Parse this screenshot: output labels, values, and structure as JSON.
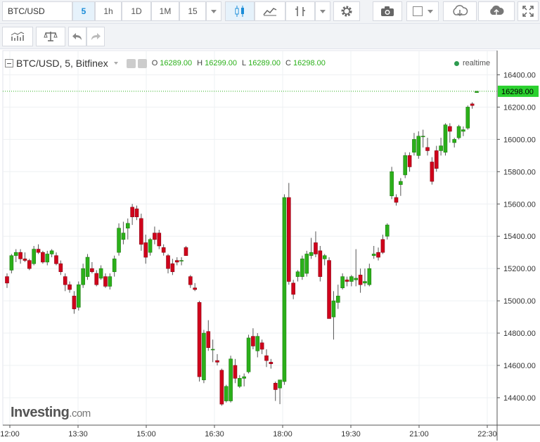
{
  "toolbar": {
    "symbol": "BTC/USD",
    "intervals": [
      "5",
      "1h",
      "1D",
      "1M",
      "15"
    ],
    "active_interval": "5"
  },
  "legend": {
    "title": "BTC/USD, 5, Bitfinex",
    "o_label": "O",
    "o_value": "16289.00",
    "h_label": "H",
    "h_value": "16299.00",
    "l_label": "L",
    "l_value": "16289.00",
    "c_label": "C",
    "c_value": "16298.00"
  },
  "realtime_label": "realtime",
  "logo": {
    "main": "Investing",
    "suffix": ".com"
  },
  "colors": {
    "up": "#2bb01a",
    "down": "#d0021b",
    "last_price_bg": "#2bd12f",
    "grid": "#eef0f3"
  },
  "chart_data": {
    "type": "candlestick",
    "y_ticks": [
      14400,
      14600,
      14800,
      15000,
      15200,
      15400,
      15600,
      15800,
      16000,
      16200,
      16400
    ],
    "y_tick_labels": [
      "14400.00",
      "14600.00",
      "14800.00",
      "15000.00",
      "15200.00",
      "15400.00",
      "15600.00",
      "15800.00",
      "16000.00",
      "16200.00",
      "16400.00"
    ],
    "ylim": [
      14230,
      16550
    ],
    "x_tick_labels": [
      "12:00",
      "13:30",
      "15:00",
      "16:30",
      "18:00",
      "19:30",
      "21:00",
      "22:30"
    ],
    "last_price": 16298.0,
    "last_price_label": "16298.00",
    "candles": [
      [
        15150,
        15170,
        15080,
        15110
      ],
      [
        15190,
        15290,
        15170,
        15280
      ],
      [
        15280,
        15320,
        15240,
        15300
      ],
      [
        15300,
        15320,
        15230,
        15260
      ],
      [
        15260,
        15300,
        15240,
        15250
      ],
      [
        15250,
        15260,
        15190,
        15200
      ],
      [
        15230,
        15340,
        15220,
        15320
      ],
      [
        15320,
        15350,
        15290,
        15300
      ],
      [
        15300,
        15310,
        15230,
        15240
      ],
      [
        15240,
        15310,
        15220,
        15290
      ],
      [
        15290,
        15320,
        15270,
        15310
      ],
      [
        15280,
        15300,
        15220,
        15230
      ],
      [
        15230,
        15250,
        15160,
        15180
      ],
      [
        15150,
        15170,
        15060,
        15100
      ],
      [
        15100,
        15120,
        15050,
        15070
      ],
      [
        15030,
        15060,
        14920,
        14950
      ],
      [
        14960,
        15120,
        14940,
        15100
      ],
      [
        15100,
        15230,
        15080,
        15200
      ],
      [
        15150,
        15290,
        15130,
        15270
      ],
      [
        15200,
        15240,
        15170,
        15180
      ],
      [
        15170,
        15190,
        15090,
        15100
      ],
      [
        15140,
        15220,
        15130,
        15200
      ],
      [
        15150,
        15170,
        15080,
        15090
      ],
      [
        15090,
        15170,
        15070,
        15150
      ],
      [
        15180,
        15280,
        15150,
        15260
      ],
      [
        15300,
        15480,
        15280,
        15450
      ],
      [
        15380,
        15490,
        15350,
        15420
      ],
      [
        15450,
        15510,
        15380,
        15480
      ],
      [
        15580,
        15600,
        15470,
        15520
      ],
      [
        15570,
        15590,
        15500,
        15520
      ],
      [
        15510,
        15540,
        15310,
        15350
      ],
      [
        15360,
        15410,
        15230,
        15270
      ],
      [
        15300,
        15390,
        15280,
        15380
      ],
      [
        15420,
        15460,
        15350,
        15380
      ],
      [
        15420,
        15440,
        15320,
        15340
      ],
      [
        15330,
        15350,
        15280,
        15300
      ],
      [
        15280,
        15290,
        15170,
        15200
      ],
      [
        15230,
        15260,
        15160,
        15180
      ],
      [
        15250,
        15270,
        15220,
        15240
      ],
      [
        15250,
        15270,
        15220,
        15250
      ],
      [
        15330,
        15340,
        15280,
        15280
      ],
      [
        15150,
        15160,
        15080,
        15100
      ],
      [
        15080,
        15110,
        15060,
        15070
      ],
      [
        14990,
        15000,
        14500,
        14530
      ],
      [
        14510,
        14820,
        14490,
        14800
      ],
      [
        14810,
        14880,
        14690,
        14710
      ],
      [
        14700,
        14760,
        14620,
        14700
      ],
      [
        14630,
        14670,
        14600,
        14620
      ],
      [
        14570,
        14580,
        14350,
        14360
      ],
      [
        14380,
        14480,
        14370,
        14470
      ],
      [
        14380,
        14660,
        14370,
        14640
      ],
      [
        14600,
        14640,
        14490,
        14520
      ],
      [
        14470,
        14540,
        14460,
        14520
      ],
      [
        14520,
        14550,
        14470,
        14530
      ],
      [
        14560,
        14790,
        14550,
        14770
      ],
      [
        14780,
        14830,
        14700,
        14720
      ],
      [
        14690,
        14800,
        14650,
        14780
      ],
      [
        14740,
        14760,
        14670,
        14700
      ],
      [
        14660,
        14700,
        14590,
        14630
      ],
      [
        14620,
        14640,
        14580,
        14610
      ],
      [
        14490,
        14500,
        14380,
        14450
      ],
      [
        14460,
        14480,
        14360,
        14510
      ],
      [
        14500,
        15660,
        14480,
        15640
      ],
      [
        15640,
        15730,
        15100,
        15120
      ],
      [
        15110,
        15130,
        15010,
        15040
      ],
      [
        15150,
        15190,
        15120,
        15180
      ],
      [
        15150,
        15280,
        15130,
        15260
      ],
      [
        15170,
        15310,
        15150,
        15290
      ],
      [
        15280,
        15390,
        15260,
        15300
      ],
      [
        15360,
        15430,
        15270,
        15290
      ],
      [
        15310,
        15340,
        15120,
        15150
      ],
      [
        15260,
        15290,
        15220,
        15280
      ],
      [
        15250,
        15270,
        14900,
        14890
      ],
      [
        14900,
        15060,
        14760,
        15000
      ],
      [
        14990,
        15100,
        14950,
        15030
      ],
      [
        15080,
        15170,
        15070,
        15150
      ],
      [
        15130,
        15150,
        15090,
        15120
      ],
      [
        15120,
        15160,
        15090,
        15150
      ],
      [
        15130,
        15320,
        15090,
        15140
      ],
      [
        15160,
        15200,
        15050,
        15100
      ],
      [
        15110,
        15200,
        15090,
        15120
      ],
      [
        15100,
        15230,
        15090,
        15200
      ],
      [
        15280,
        15340,
        15260,
        15290
      ],
      [
        15300,
        15330,
        15250,
        15270
      ],
      [
        15380,
        15410,
        15290,
        15300
      ],
      [
        15400,
        15480,
        15380,
        15470
      ],
      [
        15650,
        15830,
        15630,
        15800
      ],
      [
        15640,
        15660,
        15590,
        15610
      ],
      [
        15720,
        15760,
        15650,
        15740
      ],
      [
        15780,
        15920,
        15760,
        15900
      ],
      [
        15900,
        15920,
        15800,
        15830
      ],
      [
        15920,
        16040,
        15900,
        16000
      ],
      [
        15900,
        16050,
        15880,
        16020
      ],
      [
        16020,
        16060,
        15950,
        16020
      ],
      [
        15950,
        16010,
        15900,
        15930
      ],
      [
        15860,
        15890,
        15720,
        15740
      ],
      [
        15930,
        15960,
        15800,
        15820
      ],
      [
        15930,
        16010,
        15900,
        15960
      ],
      [
        15920,
        16100,
        15900,
        16090
      ],
      [
        16080,
        16100,
        15980,
        16050
      ],
      [
        15980,
        16010,
        15950,
        16000
      ],
      [
        16010,
        16090,
        16000,
        16080
      ],
      [
        16050,
        16080,
        16020,
        16060
      ],
      [
        16070,
        16210,
        16060,
        16200
      ],
      [
        16220,
        16230,
        16190,
        16210
      ],
      [
        16290,
        16299,
        16289,
        16298
      ]
    ]
  }
}
